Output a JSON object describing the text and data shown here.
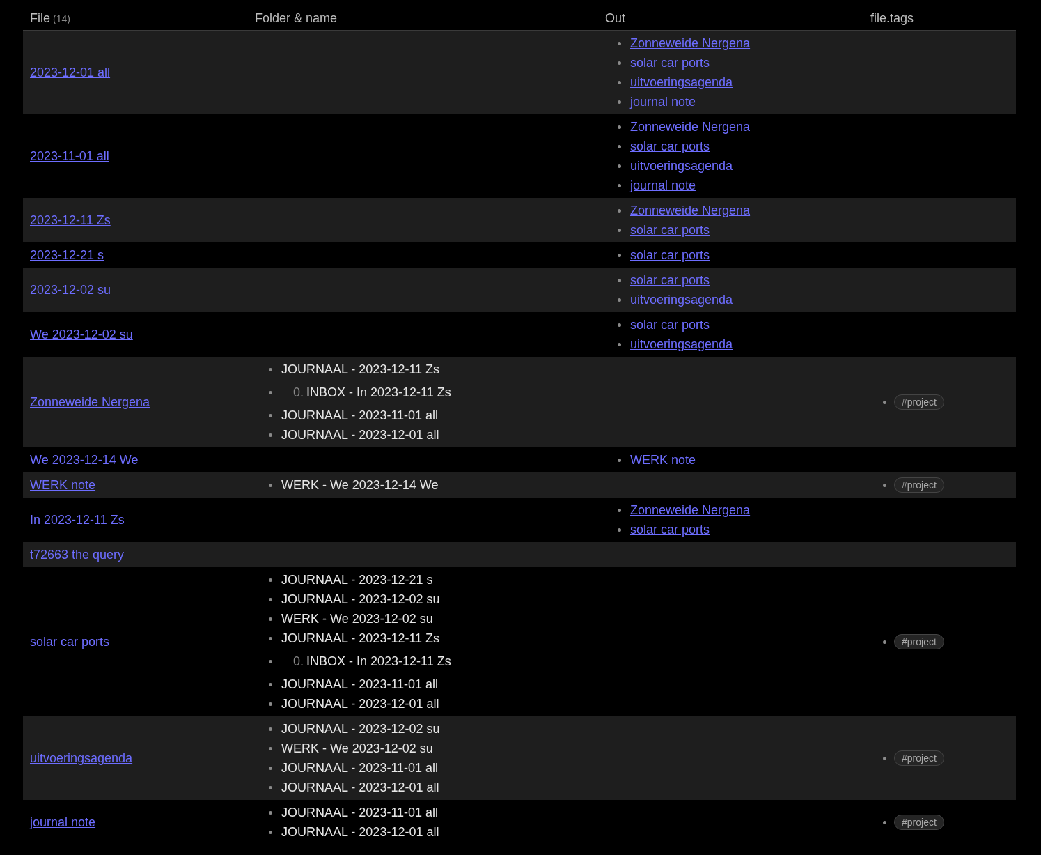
{
  "table": {
    "columns": [
      {
        "label": "File",
        "count": "(14)"
      },
      {
        "label": "Folder & name"
      },
      {
        "label": "Out"
      },
      {
        "label": "file.tags"
      }
    ],
    "rows": [
      {
        "file": "2023-12-01 all",
        "folder": [],
        "out": [
          "Zonneweide Nergena",
          "solar car ports",
          "uitvoeringsagenda",
          "journal note"
        ],
        "tags": []
      },
      {
        "file": "2023-11-01 all",
        "folder": [],
        "out": [
          "Zonneweide Nergena",
          "solar car ports",
          "uitvoeringsagenda",
          "journal note"
        ],
        "tags": []
      },
      {
        "file": "2023-12-11 Zs",
        "folder": [],
        "out": [
          "Zonneweide Nergena",
          "solar car ports"
        ],
        "tags": []
      },
      {
        "file": "2023-12-21 s",
        "folder": [],
        "out": [
          "solar car ports"
        ],
        "tags": []
      },
      {
        "file": "2023-12-02 su",
        "folder": [],
        "out": [
          "solar car ports",
          "uitvoeringsagenda"
        ],
        "tags": []
      },
      {
        "file": "We 2023-12-02 su",
        "folder": [],
        "out": [
          "solar car ports",
          "uitvoeringsagenda"
        ],
        "tags": []
      },
      {
        "file": "Zonneweide Nergena",
        "folder": [
          {
            "kind": "plain",
            "text": "JOURNAAL - 2023-12-11 Zs"
          },
          {
            "kind": "numbered",
            "number": "0.",
            "text": "INBOX - In 2023-12-11 Zs"
          },
          {
            "kind": "plain",
            "text": "JOURNAAL - 2023-11-01 all"
          },
          {
            "kind": "plain",
            "text": "JOURNAAL - 2023-12-01 all"
          }
        ],
        "out": [],
        "tags": [
          "#project"
        ]
      },
      {
        "file": "We 2023-12-14 We",
        "folder": [],
        "out": [
          "WERK note"
        ],
        "tags": []
      },
      {
        "file": "WERK note",
        "folder": [
          {
            "kind": "plain",
            "text": "WERK - We 2023-12-14 We"
          }
        ],
        "out": [],
        "tags": [
          "#project"
        ]
      },
      {
        "file": "In 2023-12-11 Zs",
        "folder": [],
        "out": [
          "Zonneweide Nergena",
          "solar car ports"
        ],
        "tags": []
      },
      {
        "file": "t72663 the query",
        "folder": [],
        "out": [],
        "tags": []
      },
      {
        "file": "solar car ports",
        "folder": [
          {
            "kind": "plain",
            "text": "JOURNAAL - 2023-12-21 s"
          },
          {
            "kind": "plain",
            "text": "JOURNAAL - 2023-12-02 su"
          },
          {
            "kind": "plain",
            "text": "WERK - We 2023-12-02 su"
          },
          {
            "kind": "plain",
            "text": "JOURNAAL - 2023-12-11 Zs"
          },
          {
            "kind": "numbered",
            "number": "0.",
            "text": "INBOX - In 2023-12-11 Zs"
          },
          {
            "kind": "plain",
            "text": "JOURNAAL - 2023-11-01 all"
          },
          {
            "kind": "plain",
            "text": "JOURNAAL - 2023-12-01 all"
          }
        ],
        "out": [],
        "tags": [
          "#project"
        ]
      },
      {
        "file": "uitvoeringsagenda",
        "folder": [
          {
            "kind": "plain",
            "text": "JOURNAAL - 2023-12-02 su"
          },
          {
            "kind": "plain",
            "text": "WERK - We 2023-12-02 su"
          },
          {
            "kind": "plain",
            "text": "JOURNAAL - 2023-11-01 all"
          },
          {
            "kind": "plain",
            "text": "JOURNAAL - 2023-12-01 all"
          }
        ],
        "out": [],
        "tags": [
          "#project"
        ]
      },
      {
        "file": "journal note",
        "folder": [
          {
            "kind": "plain",
            "text": "JOURNAAL - 2023-11-01 all"
          },
          {
            "kind": "plain",
            "text": "JOURNAAL - 2023-12-01 all"
          }
        ],
        "out": [],
        "tags": [
          "#project"
        ]
      }
    ]
  }
}
